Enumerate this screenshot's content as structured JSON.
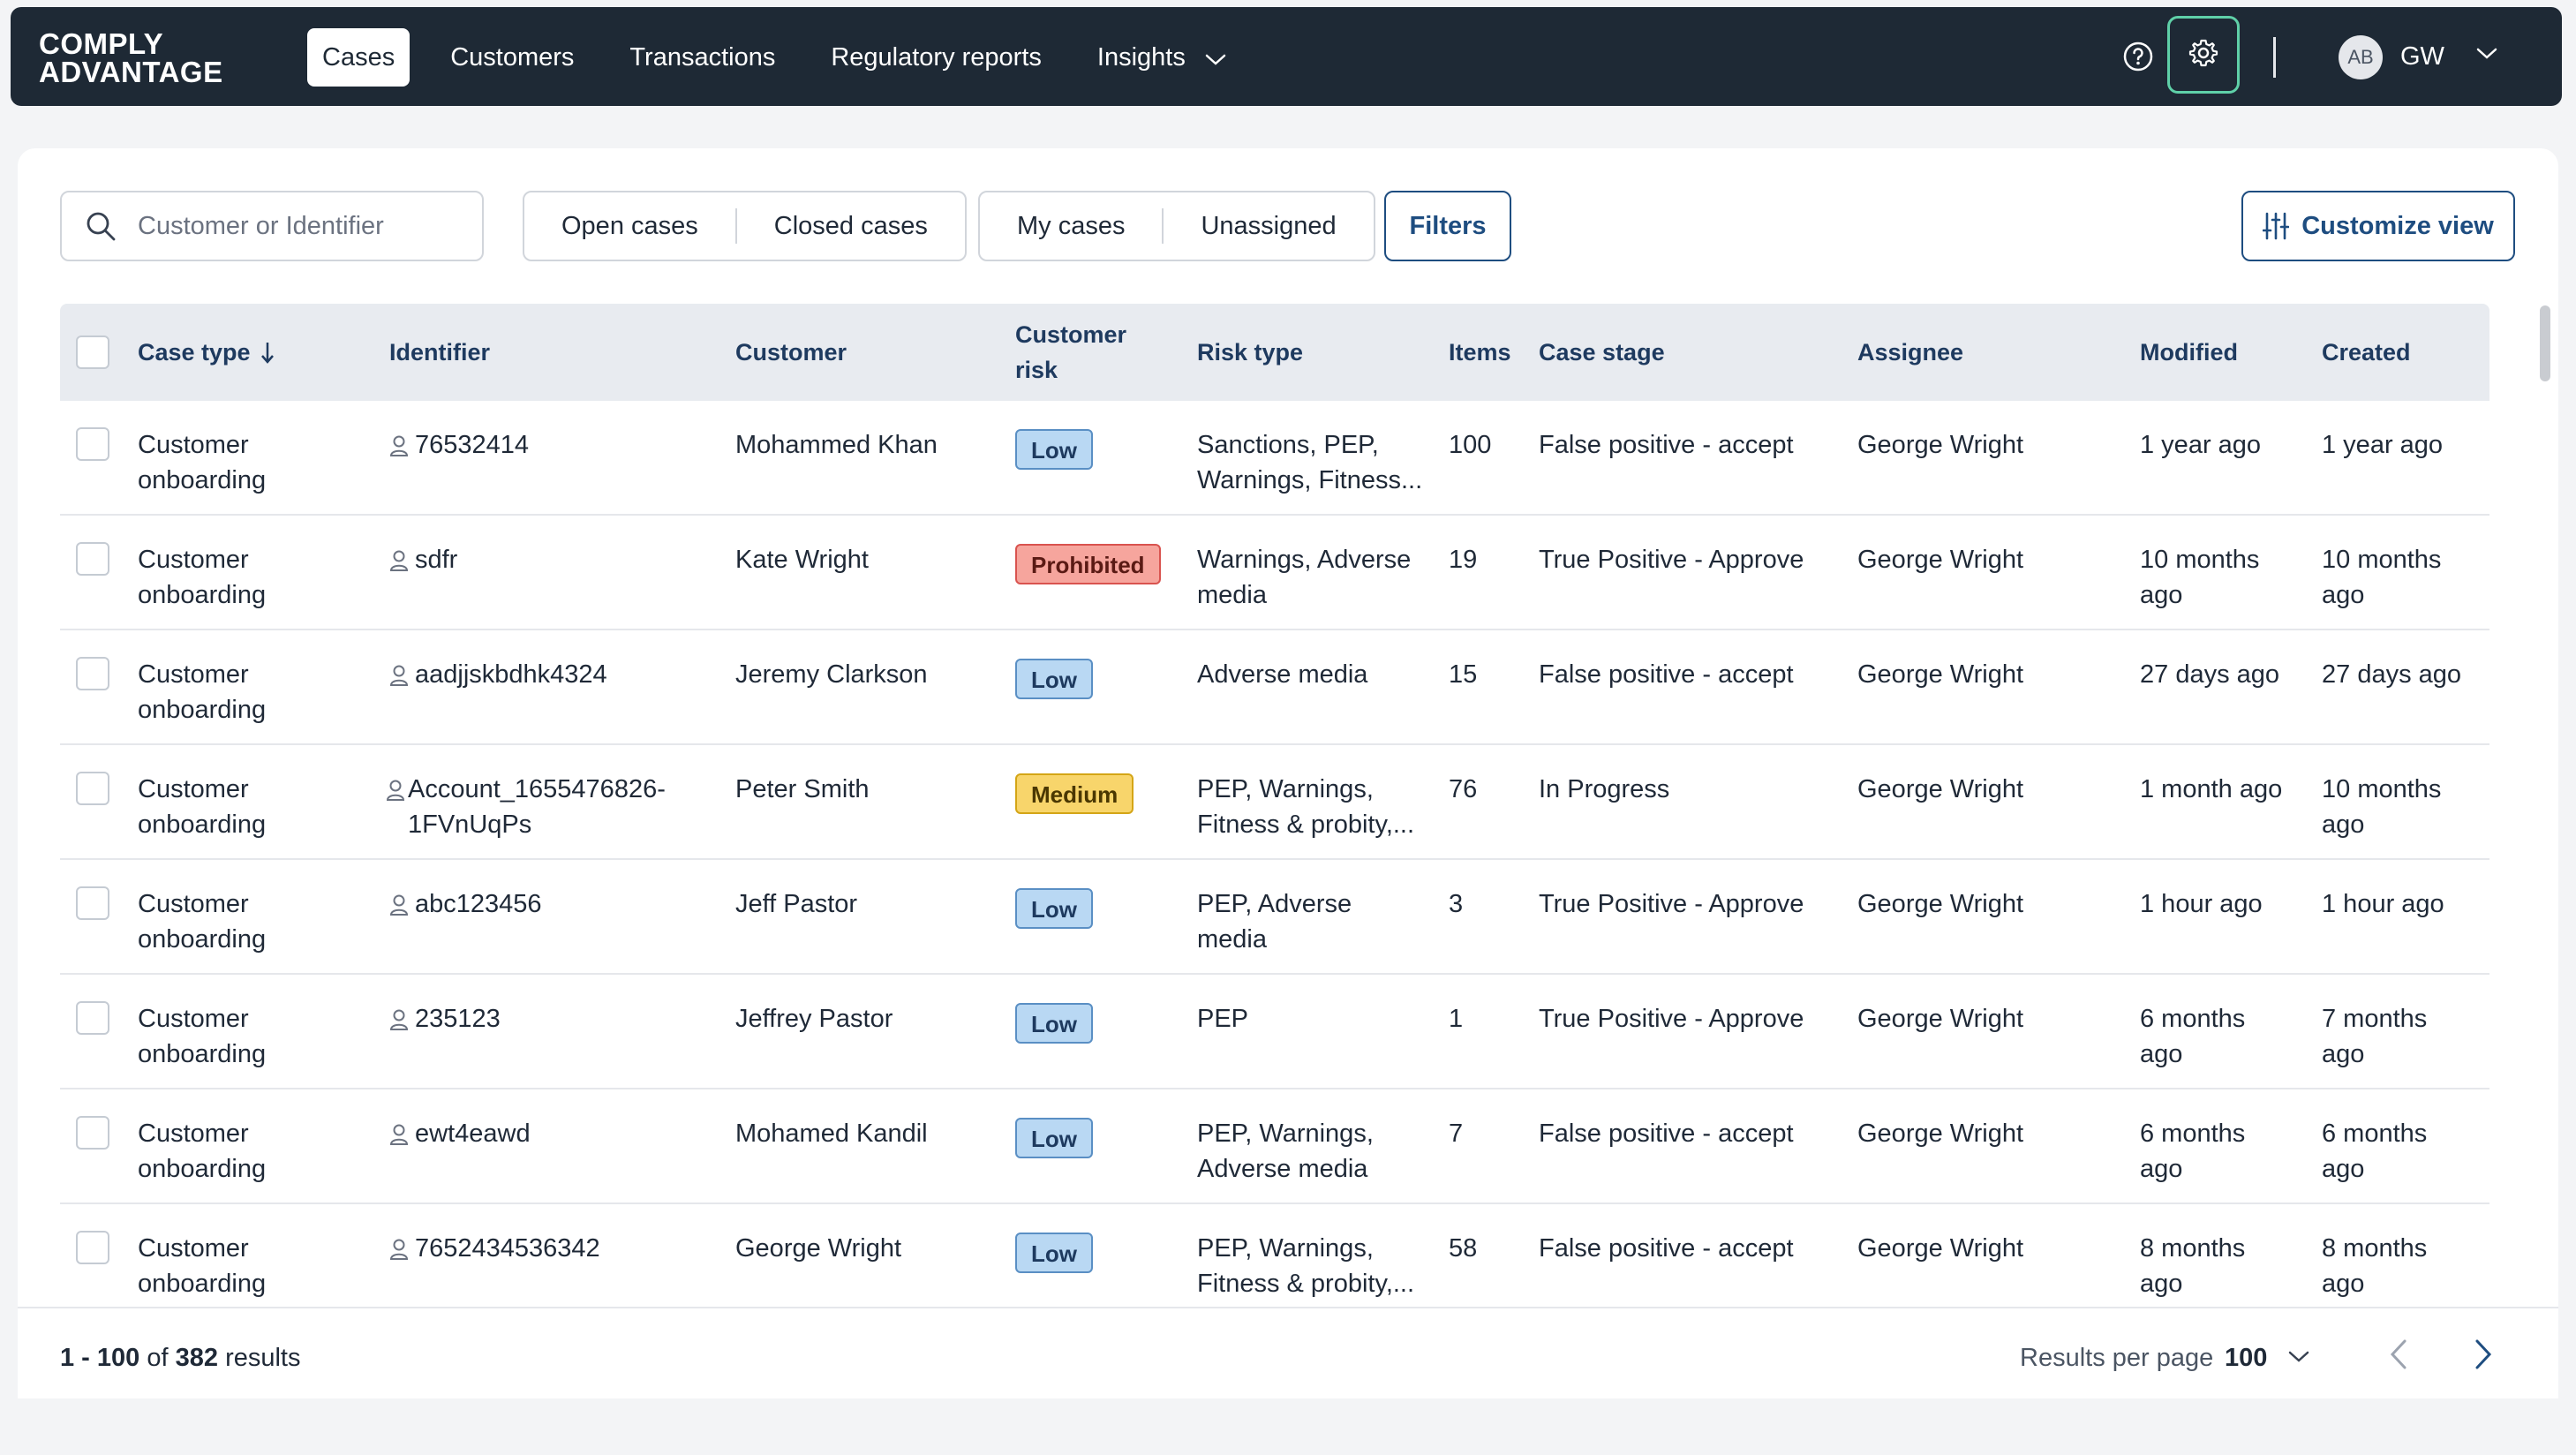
{
  "brand": {
    "line1": "COMPLY",
    "line2": "ADVANTAGE"
  },
  "nav": {
    "items": [
      {
        "label": "Cases",
        "active": true
      },
      {
        "label": "Customers"
      },
      {
        "label": "Transactions"
      },
      {
        "label": "Regulatory reports"
      },
      {
        "label": "Insights"
      }
    ],
    "user": {
      "avatar_initials": "AB",
      "initials": "GW"
    }
  },
  "toolbar": {
    "search_placeholder": "Customer or Identifier",
    "status_tabs": [
      "Open cases",
      "Closed cases"
    ],
    "owner_tabs": [
      "My cases",
      "Unassigned"
    ],
    "filters_label": "Filters",
    "customize_label": "Customize view"
  },
  "table": {
    "headers": {
      "case_type": "Case type",
      "identifier": "Identifier",
      "customer": "Customer",
      "customer_risk_1": "Customer",
      "customer_risk_2": "risk",
      "risk_type": "Risk type",
      "items": "Items",
      "case_stage": "Case stage",
      "assignee": "Assignee",
      "modified": "Modified",
      "created": "Created"
    },
    "rows": [
      {
        "case_type": [
          "Customer",
          "onboarding"
        ],
        "identifier": [
          "76532414"
        ],
        "customer": "Mohammed Khan",
        "risk": "Low",
        "risk_type": [
          "Sanctions, PEP,",
          "Warnings, Fitness..."
        ],
        "items": "100",
        "stage": "False positive - accept",
        "assignee": "George Wright",
        "modified": [
          "1 year ago"
        ],
        "created": [
          "1 year ago"
        ]
      },
      {
        "case_type": [
          "Customer",
          "onboarding"
        ],
        "identifier": [
          "sdfr"
        ],
        "customer": "Kate Wright",
        "risk": "Prohibited",
        "risk_type": [
          "Warnings, Adverse",
          "media"
        ],
        "items": "19",
        "stage": "True Positive - Approve",
        "assignee": "George Wright",
        "modified": [
          "10 months",
          "ago"
        ],
        "created": [
          "10 months",
          "ago"
        ]
      },
      {
        "case_type": [
          "Customer",
          "onboarding"
        ],
        "identifier": [
          "aadjjskbdhk4324"
        ],
        "customer": "Jeremy Clarkson",
        "risk": "Low",
        "risk_type": [
          "Adverse media"
        ],
        "items": "15",
        "stage": "False positive - accept",
        "assignee": "George Wright",
        "modified": [
          "27 days ago"
        ],
        "created": [
          "27 days ago"
        ]
      },
      {
        "case_type": [
          "Customer",
          "onboarding"
        ],
        "identifier": [
          "Account_1655476826-",
          "1FVnUqPs"
        ],
        "customer": "Peter Smith",
        "risk": "Medium",
        "risk_type": [
          "PEP, Warnings,",
          "Fitness & probity,..."
        ],
        "items": "76",
        "stage": "In Progress",
        "assignee": "George Wright",
        "modified": [
          "1 month ago"
        ],
        "created": [
          "10 months",
          "ago"
        ]
      },
      {
        "case_type": [
          "Customer",
          "onboarding"
        ],
        "identifier": [
          "abc123456"
        ],
        "customer": "Jeff Pastor",
        "risk": "Low",
        "risk_type": [
          "PEP, Adverse",
          "media"
        ],
        "items": "3",
        "stage": "True Positive - Approve",
        "assignee": "George Wright",
        "modified": [
          "1 hour ago"
        ],
        "created": [
          "1 hour ago"
        ]
      },
      {
        "case_type": [
          "Customer",
          "onboarding"
        ],
        "identifier": [
          "235123"
        ],
        "customer": "Jeffrey Pastor",
        "risk": "Low",
        "risk_type": [
          "PEP"
        ],
        "items": "1",
        "stage": "True Positive - Approve",
        "assignee": "George Wright",
        "modified": [
          "6 months",
          "ago"
        ],
        "created": [
          "7 months",
          "ago"
        ]
      },
      {
        "case_type": [
          "Customer",
          "onboarding"
        ],
        "identifier": [
          "ewt4eawd"
        ],
        "customer": "Mohamed Kandil",
        "risk": "Low",
        "risk_type": [
          "PEP, Warnings,",
          "Adverse media"
        ],
        "items": "7",
        "stage": "False positive - accept",
        "assignee": "George Wright",
        "modified": [
          "6 months",
          "ago"
        ],
        "created": [
          "6 months",
          "ago"
        ]
      },
      {
        "case_type": [
          "Customer",
          "onboarding"
        ],
        "identifier": [
          "7652434536342"
        ],
        "customer": "George Wright",
        "risk": "Low",
        "risk_type": [
          "PEP, Warnings,",
          "Fitness & probity,..."
        ],
        "items": "58",
        "stage": "False positive - accept",
        "assignee": "George Wright",
        "modified": [
          "8 months",
          "ago"
        ],
        "created": [
          "8 months",
          "ago"
        ]
      }
    ]
  },
  "risk_colors": {
    "Low": {
      "bg": "#b9d8f3",
      "border": "#5a8fc4",
      "text": "#1e3a5f"
    },
    "Prohibited": {
      "bg": "#f6a59d",
      "border": "#d9534f",
      "text": "#5a1a14"
    },
    "Medium": {
      "bg": "#f8d56b",
      "border": "#d4a516",
      "text": "#4a3700"
    }
  },
  "footer": {
    "range": "1 - 100",
    "of_word": "of",
    "total": "382",
    "results_word": "results",
    "per_page_label": "Results per page",
    "per_page_value": "100"
  }
}
